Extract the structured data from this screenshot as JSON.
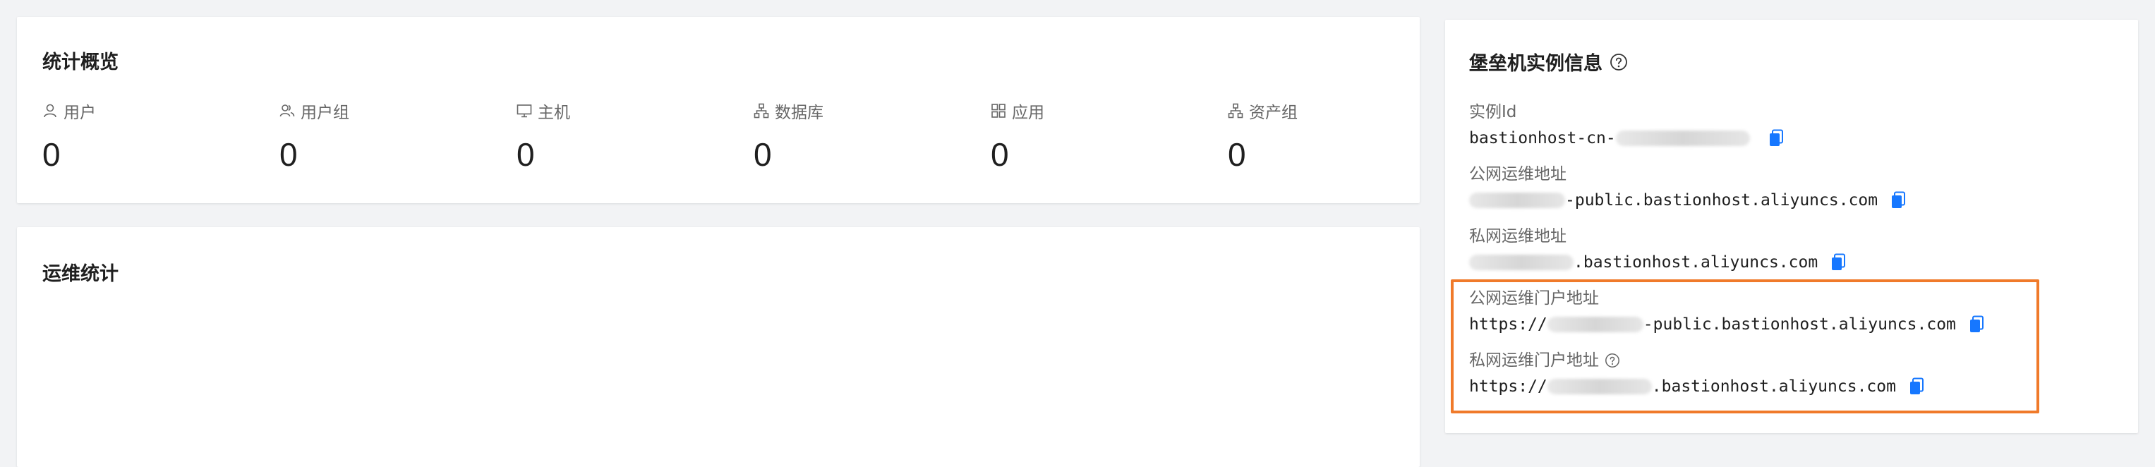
{
  "stats_card": {
    "title": "统计概览",
    "items": [
      {
        "label": "用户",
        "value": "0",
        "icon": "user-icon"
      },
      {
        "label": "用户组",
        "value": "0",
        "icon": "user-group-icon"
      },
      {
        "label": "主机",
        "value": "0",
        "icon": "monitor-icon"
      },
      {
        "label": "数据库",
        "value": "0",
        "icon": "database-icon"
      },
      {
        "label": "应用",
        "value": "0",
        "icon": "app-grid-icon"
      },
      {
        "label": "资产组",
        "value": "0",
        "icon": "asset-group-icon"
      }
    ]
  },
  "ops_card": {
    "title": "运维统计"
  },
  "info_card": {
    "title": "堡垒机实例信息",
    "fields": [
      {
        "label": "实例Id",
        "prefix": "bastionhost-cn-",
        "suffix": ""
      },
      {
        "label": "公网运维地址",
        "prefix": "",
        "suffix": "-public.bastionhost.aliyuncs.com"
      },
      {
        "label": "私网运维地址",
        "prefix": "",
        "suffix": ".bastionhost.aliyuncs.com"
      },
      {
        "label": "公网运维门户地址",
        "prefix": "https://",
        "suffix": "-public.bastionhost.aliyuncs.com"
      },
      {
        "label": "私网运维门户地址",
        "prefix": "https://",
        "suffix": ".bastionhost.aliyuncs.com"
      }
    ]
  },
  "colors": {
    "accent": "#1677ff",
    "highlight": "#f07a2a"
  }
}
